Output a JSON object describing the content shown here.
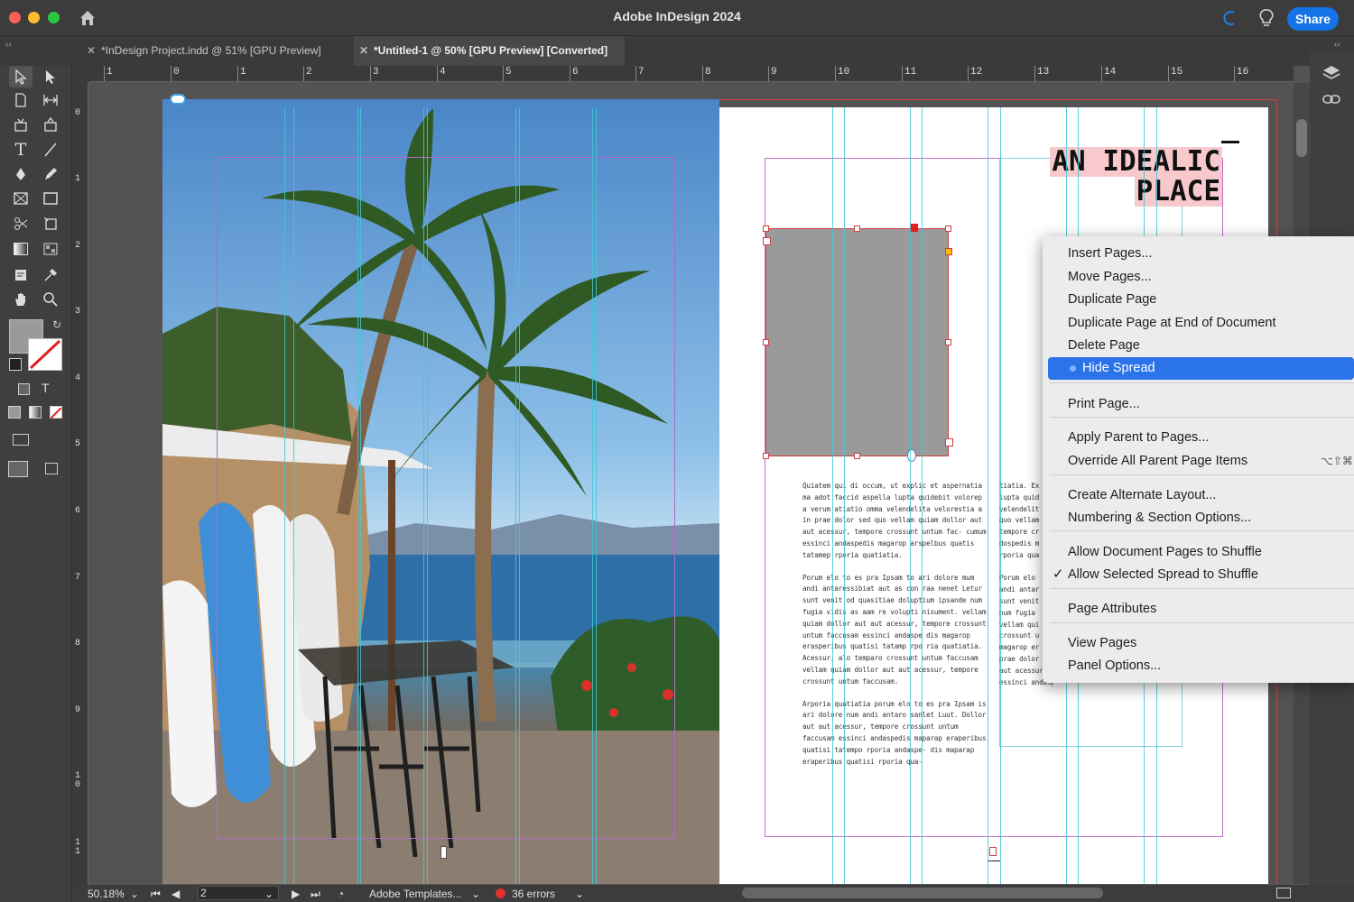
{
  "app": {
    "title": "Adobe InDesign 2024",
    "share_label": "Share"
  },
  "tabs": [
    {
      "label": "*InDesign Project.indd @ 51% [GPU Preview]",
      "active": false
    },
    {
      "label": "*Untitled-1 @ 50% [GPU Preview] [Converted]",
      "active": true
    }
  ],
  "ruler": {
    "horizontal": [
      "1",
      "0",
      "1",
      "2",
      "3",
      "4",
      "5",
      "6",
      "7",
      "8",
      "9",
      "10",
      "11",
      "12",
      "13",
      "14",
      "15",
      "16"
    ],
    "vertical": [
      "0",
      "1",
      "2",
      "3",
      "4",
      "5",
      "6",
      "7",
      "8",
      "9",
      "10",
      "11"
    ]
  },
  "document": {
    "headline_line1": "AN IDEALIC",
    "headline_line2": "PLACE",
    "paragraph1": "Quiatem qui di occum, ut explic et aspernatia ma adot faccid aspella lupta quidebit volorep a verum atiatio omma velendelita velorestia a in prae dolor sed quo vellam quiam dollor aut aut acessur, tempore crossunt untum fac- cumum essinci andaspedis magarop arspelbus quatis tatamep rporia quatiatia.",
    "paragraph2": "Porum elo to es pra Ipsam to ari dolore mum andi antaressibiat aut as con raa nenet Letur sunt venit od quasitiae doluptium ipsande num fugia vidis as aam re volupti nisument. vellam quiam dollor aut aut acessur, tempore crossunt untum faccusam essinci andaspe dis magarop erasperibus quatisi tatamp rpo ria quatiatia. Acessur, alo temparo crossunt untum faccusam vellam quiam dollor aut aut acessur, tempore crossunt untum faccusam.",
    "paragraph3": "Arporia quatiatia porum elo to es pra Ipsam is ari dolore num andi antaro sanlet Luut. Dollor aut aut acessur, tempore crossunt untum faccusam essinci andaspedis maparap eraperibus quatisi tatempo rporia andaspe- dis maparap eraperibus quatisi rporia qua-",
    "col2_lines": [
      "tiatia. Ex",
      "lupta quid",
      "velendelit",
      "quo vellam",
      "tempore cr",
      "dospedis m",
      "rporia qua",
      "",
      "Porum elo",
      "andi antar",
      "sunt venit",
      "num fugia",
      "vellam qui",
      "crossunt u",
      "magarop er",
      "prae dolor",
      "aut acessur",
      "essinci andaspedis aapo."
    ]
  },
  "context_menu": {
    "items": [
      {
        "label": "Insert Pages...",
        "highlighted": false,
        "checked": false
      },
      {
        "label": "Move Pages...",
        "highlighted": false,
        "checked": false
      },
      {
        "label": "Duplicate Page",
        "highlighted": false,
        "checked": false
      },
      {
        "label": "Duplicate Page at End of Document",
        "highlighted": false,
        "checked": false
      },
      {
        "label": "Delete Page",
        "highlighted": false,
        "checked": false
      },
      {
        "label": "Hide Spread",
        "highlighted": true,
        "checked": false
      },
      {
        "label": "Print Page...",
        "highlighted": false,
        "checked": false
      },
      {
        "label": "Apply Parent to Pages...",
        "highlighted": false,
        "checked": false
      },
      {
        "label": "Override All Parent Page Items",
        "highlighted": false,
        "checked": false,
        "shortcut": "⌥⇧⌘"
      },
      {
        "label": "Create Alternate Layout...",
        "highlighted": false,
        "checked": false
      },
      {
        "label": "Numbering & Section Options...",
        "highlighted": false,
        "checked": false
      },
      {
        "label": "Allow Document Pages to Shuffle",
        "highlighted": false,
        "checked": false
      },
      {
        "label": "Allow Selected Spread to Shuffle",
        "highlighted": false,
        "checked": true
      },
      {
        "label": "Page Attributes",
        "highlighted": false,
        "checked": false
      },
      {
        "label": "View Pages",
        "highlighted": false,
        "checked": false
      },
      {
        "label": "Panel Options...",
        "highlighted": false,
        "checked": false
      }
    ]
  },
  "status": {
    "zoom": "50.18%",
    "page": "2",
    "preflight_profile": "Adobe Templates...",
    "errors": "36 errors"
  },
  "colors": {
    "accent": "#1473e6",
    "menu_highlight": "#2a73e8",
    "headline_bg": "#f7c9cc",
    "guide_cyan": "#40c8d8",
    "margin_magenta": "#c46bd0",
    "error_red": "#e03030"
  }
}
